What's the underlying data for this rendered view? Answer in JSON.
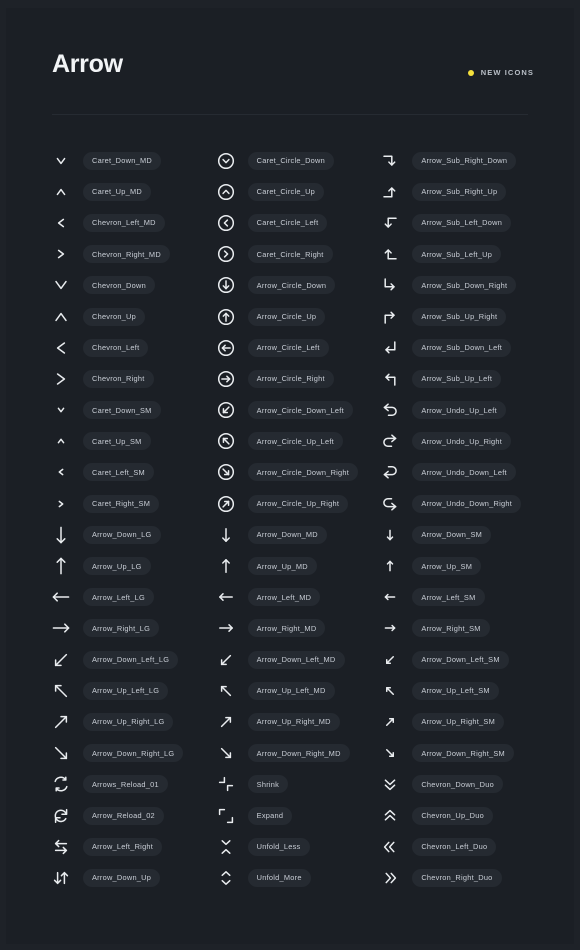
{
  "header": {
    "title": "Arrow",
    "badge_label": "NEW ICONS",
    "badge_dot_icon": "yellow-dot-icon",
    "badge_color": "#f5e03c"
  },
  "theme": {
    "page_background": "#1e2228",
    "panel_background": "#1b1f25",
    "pill_background": "#252a31",
    "pill_text": "#c9ced6",
    "icon_color": "#e9ecef",
    "divider": "#262b32"
  },
  "columns": [
    {
      "index": 0,
      "items": [
        {
          "icon": "caret-down-md-icon",
          "label": "Caret_Down_MD",
          "glyph": "caret",
          "dir": "down",
          "size": "md"
        },
        {
          "icon": "caret-up-md-icon",
          "label": "Caret_Up_MD",
          "glyph": "caret",
          "dir": "up",
          "size": "md"
        },
        {
          "icon": "chevron-left-md-icon",
          "label": "Chevron_Left_MD",
          "glyph": "caret",
          "dir": "left",
          "size": "md"
        },
        {
          "icon": "chevron-right-md-icon",
          "label": "Chevron_Right_MD",
          "glyph": "caret",
          "dir": "right",
          "size": "md"
        },
        {
          "icon": "chevron-down-icon",
          "label": "Chevron_Down",
          "glyph": "caret",
          "dir": "down",
          "size": "lg"
        },
        {
          "icon": "chevron-up-icon",
          "label": "Chevron_Up",
          "glyph": "caret",
          "dir": "up",
          "size": "lg"
        },
        {
          "icon": "chevron-left-icon",
          "label": "Chevron_Left",
          "glyph": "caret",
          "dir": "left",
          "size": "lg"
        },
        {
          "icon": "chevron-right-icon",
          "label": "Chevron_Right",
          "glyph": "caret",
          "dir": "right",
          "size": "lg"
        },
        {
          "icon": "caret-down-sm-icon",
          "label": "Caret_Down_SM",
          "glyph": "caret",
          "dir": "down",
          "size": "sm"
        },
        {
          "icon": "caret-up-sm-icon",
          "label": "Caret_Up_SM",
          "glyph": "caret",
          "dir": "up",
          "size": "sm"
        },
        {
          "icon": "caret-left-sm-icon",
          "label": "Caret_Left_SM",
          "glyph": "caret",
          "dir": "left",
          "size": "sm"
        },
        {
          "icon": "caret-right-sm-icon",
          "label": "Caret_Right_SM",
          "glyph": "caret",
          "dir": "right",
          "size": "sm"
        },
        {
          "icon": "arrow-down-lg-icon",
          "label": "Arrow_Down_LG",
          "glyph": "arrow",
          "dir": "down",
          "size": "lg"
        },
        {
          "icon": "arrow-up-lg-icon",
          "label": "Arrow_Up_LG",
          "glyph": "arrow",
          "dir": "up",
          "size": "lg"
        },
        {
          "icon": "arrow-left-lg-icon",
          "label": "Arrow_Left_LG",
          "glyph": "arrow",
          "dir": "left",
          "size": "lg"
        },
        {
          "icon": "arrow-right-lg-icon",
          "label": "Arrow_Right_LG",
          "glyph": "arrow",
          "dir": "right",
          "size": "lg"
        },
        {
          "icon": "arrow-down-left-lg-icon",
          "label": "Arrow_Down_Left_LG",
          "glyph": "arrow",
          "dir": "down-left",
          "size": "lg"
        },
        {
          "icon": "arrow-up-left-lg-icon",
          "label": "Arrow_Up_Left_LG",
          "glyph": "arrow",
          "dir": "up-left",
          "size": "lg"
        },
        {
          "icon": "arrow-up-right-lg-icon",
          "label": "Arrow_Up_Right_LG",
          "glyph": "arrow",
          "dir": "up-right",
          "size": "lg"
        },
        {
          "icon": "arrow-down-right-lg-icon",
          "label": "Arrow_Down_Right_LG",
          "glyph": "arrow",
          "dir": "down-right",
          "size": "lg"
        },
        {
          "icon": "arrows-reload-01-icon",
          "label": "Arrows_Reload_01",
          "glyph": "reload01",
          "dir": "",
          "size": "md"
        },
        {
          "icon": "arrow-reload-02-icon",
          "label": "Arrow_Reload_02",
          "glyph": "reload02",
          "dir": "",
          "size": "md"
        },
        {
          "icon": "arrow-left-right-icon",
          "label": "Arrow_Left_Right",
          "glyph": "leftright",
          "dir": "",
          "size": "md"
        },
        {
          "icon": "arrow-down-up-icon",
          "label": "Arrow_Down_Up",
          "glyph": "downup",
          "dir": "",
          "size": "md"
        }
      ]
    },
    {
      "index": 1,
      "items": [
        {
          "icon": "caret-circle-down-icon",
          "label": "Caret_Circle_Down",
          "glyph": "circle-caret",
          "dir": "down",
          "size": "md"
        },
        {
          "icon": "caret-circle-up-icon",
          "label": "Caret_Circle_Up",
          "glyph": "circle-caret",
          "dir": "up",
          "size": "md"
        },
        {
          "icon": "caret-circle-left-icon",
          "label": "Caret_Circle_Left",
          "glyph": "circle-caret",
          "dir": "left",
          "size": "md"
        },
        {
          "icon": "caret-circle-right-icon",
          "label": "Caret_Circle_Right",
          "glyph": "circle-caret",
          "dir": "right",
          "size": "md"
        },
        {
          "icon": "arrow-circle-down-icon",
          "label": "Arrow_Circle_Down",
          "glyph": "circle-arrow",
          "dir": "down",
          "size": "md"
        },
        {
          "icon": "arrow-circle-up-icon",
          "label": "Arrow_Circle_Up",
          "glyph": "circle-arrow",
          "dir": "up",
          "size": "md"
        },
        {
          "icon": "arrow-circle-left-icon",
          "label": "Arrow_Circle_Left",
          "glyph": "circle-arrow",
          "dir": "left",
          "size": "md"
        },
        {
          "icon": "arrow-circle-right-icon",
          "label": "Arrow_Circle_Right",
          "glyph": "circle-arrow",
          "dir": "right",
          "size": "md"
        },
        {
          "icon": "arrow-circle-down-left-icon",
          "label": "Arrow_Circle_Down_Left",
          "glyph": "circle-arrow",
          "dir": "down-left",
          "size": "md"
        },
        {
          "icon": "arrow-circle-up-left-icon",
          "label": "Arrow_Circle_Up_Left",
          "glyph": "circle-arrow",
          "dir": "up-left",
          "size": "md"
        },
        {
          "icon": "arrow-circle-down-right-icon",
          "label": "Arrow_Circle_Down_Right",
          "glyph": "circle-arrow",
          "dir": "down-right",
          "size": "md"
        },
        {
          "icon": "arrow-circle-up-right-icon",
          "label": "Arrow_Circle_Up_Right",
          "glyph": "circle-arrow",
          "dir": "up-right",
          "size": "md"
        },
        {
          "icon": "arrow-down-md-icon",
          "label": "Arrow_Down_MD",
          "glyph": "arrow",
          "dir": "down",
          "size": "md"
        },
        {
          "icon": "arrow-up-md-icon",
          "label": "Arrow_Up_MD",
          "glyph": "arrow",
          "dir": "up",
          "size": "md"
        },
        {
          "icon": "arrow-left-md-icon",
          "label": "Arrow_Left_MD",
          "glyph": "arrow",
          "dir": "left",
          "size": "md"
        },
        {
          "icon": "arrow-right-md-icon",
          "label": "Arrow_Right_MD",
          "glyph": "arrow",
          "dir": "right",
          "size": "md"
        },
        {
          "icon": "arrow-down-left-md-icon",
          "label": "Arrow_Down_Left_MD",
          "glyph": "arrow",
          "dir": "down-left",
          "size": "md"
        },
        {
          "icon": "arrow-up-left-md-icon",
          "label": "Arrow_Up_Left_MD",
          "glyph": "arrow",
          "dir": "up-left",
          "size": "md"
        },
        {
          "icon": "arrow-up-right-md-icon",
          "label": "Arrow_Up_Right_MD",
          "glyph": "arrow",
          "dir": "up-right",
          "size": "md"
        },
        {
          "icon": "arrow-down-right-md-icon",
          "label": "Arrow_Down_Right_MD",
          "glyph": "arrow",
          "dir": "down-right",
          "size": "md"
        },
        {
          "icon": "shrink-icon",
          "label": "Shrink",
          "glyph": "shrink",
          "dir": "",
          "size": "md"
        },
        {
          "icon": "expand-icon",
          "label": "Expand",
          "glyph": "expand",
          "dir": "",
          "size": "md"
        },
        {
          "icon": "unfold-less-icon",
          "label": "Unfold_Less",
          "glyph": "unfoldless",
          "dir": "",
          "size": "md"
        },
        {
          "icon": "unfold-more-icon",
          "label": "Unfold_More",
          "glyph": "unfoldmore",
          "dir": "",
          "size": "md"
        }
      ]
    },
    {
      "index": 2,
      "items": [
        {
          "icon": "arrow-sub-right-down-icon",
          "label": "Arrow_Sub_Right_Down",
          "glyph": "sub",
          "dir": "right-down",
          "size": "md"
        },
        {
          "icon": "arrow-sub-right-up-icon",
          "label": "Arrow_Sub_Right_Up",
          "glyph": "sub",
          "dir": "right-up",
          "size": "md"
        },
        {
          "icon": "arrow-sub-left-down-icon",
          "label": "Arrow_Sub_Left_Down",
          "glyph": "sub",
          "dir": "left-down",
          "size": "md"
        },
        {
          "icon": "arrow-sub-left-up-icon",
          "label": "Arrow_Sub_Left_Up",
          "glyph": "sub",
          "dir": "left-up",
          "size": "md"
        },
        {
          "icon": "arrow-sub-down-right-icon",
          "label": "Arrow_Sub_Down_Right",
          "glyph": "sub",
          "dir": "down-right",
          "size": "md"
        },
        {
          "icon": "arrow-sub-up-right-icon",
          "label": "Arrow_Sub_Up_Right",
          "glyph": "sub",
          "dir": "up-right",
          "size": "md"
        },
        {
          "icon": "arrow-sub-down-left-icon",
          "label": "Arrow_Sub_Down_Left",
          "glyph": "sub",
          "dir": "down-left",
          "size": "md"
        },
        {
          "icon": "arrow-sub-up-left-icon",
          "label": "Arrow_Sub_Up_Left",
          "glyph": "sub",
          "dir": "up-left",
          "size": "md"
        },
        {
          "icon": "arrow-undo-up-left-icon",
          "label": "Arrow_Undo_Up_Left",
          "glyph": "undo",
          "dir": "up-left",
          "size": "md"
        },
        {
          "icon": "arrow-undo-up-right-icon",
          "label": "Arrow_Undo_Up_Right",
          "glyph": "undo",
          "dir": "up-right",
          "size": "md"
        },
        {
          "icon": "arrow-undo-down-left-icon",
          "label": "Arrow_Undo_Down_Left",
          "glyph": "undo",
          "dir": "down-left",
          "size": "md"
        },
        {
          "icon": "arrow-undo-down-right-icon",
          "label": "Arrow_Undo_Down_Right",
          "glyph": "undo",
          "dir": "down-right",
          "size": "md"
        },
        {
          "icon": "arrow-down-sm-icon",
          "label": "Arrow_Down_SM",
          "glyph": "arrow",
          "dir": "down",
          "size": "sm"
        },
        {
          "icon": "arrow-up-sm-icon",
          "label": "Arrow_Up_SM",
          "glyph": "arrow",
          "dir": "up",
          "size": "sm"
        },
        {
          "icon": "arrow-left-sm-icon",
          "label": "Arrow_Left_SM",
          "glyph": "arrow",
          "dir": "left",
          "size": "sm"
        },
        {
          "icon": "arrow-right-sm-icon",
          "label": "Arrow_Right_SM",
          "glyph": "arrow",
          "dir": "right",
          "size": "sm"
        },
        {
          "icon": "arrow-down-left-sm-icon",
          "label": "Arrow_Down_Left_SM",
          "glyph": "arrow",
          "dir": "down-left",
          "size": "sm"
        },
        {
          "icon": "arrow-up-left-sm-icon",
          "label": "Arrow_Up_Left_SM",
          "glyph": "arrow",
          "dir": "up-left",
          "size": "sm"
        },
        {
          "icon": "arrow-up-right-sm-icon",
          "label": "Arrow_Up_Right_SM",
          "glyph": "arrow",
          "dir": "up-right",
          "size": "sm"
        },
        {
          "icon": "arrow-down-right-sm-icon",
          "label": "Arrow_Down_Right_SM",
          "glyph": "arrow",
          "dir": "down-right",
          "size": "sm"
        },
        {
          "icon": "chevron-down-duo-icon",
          "label": "Chevron_Down_Duo",
          "glyph": "duo",
          "dir": "down",
          "size": "md"
        },
        {
          "icon": "chevron-up-duo-icon",
          "label": "Chevron_Up_Duo",
          "glyph": "duo",
          "dir": "up",
          "size": "md"
        },
        {
          "icon": "chevron-left-duo-icon",
          "label": "Chevron_Left_Duo",
          "glyph": "duo",
          "dir": "left",
          "size": "md"
        },
        {
          "icon": "chevron-right-duo-icon",
          "label": "Chevron_Right_Duo",
          "glyph": "duo",
          "dir": "right",
          "size": "md"
        }
      ]
    }
  ]
}
